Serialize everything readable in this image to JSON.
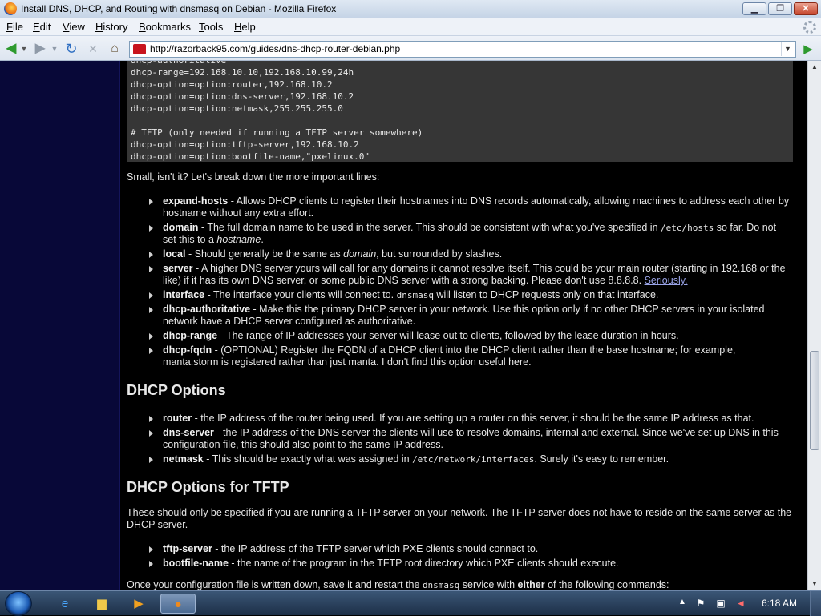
{
  "window": {
    "title": "Install DNS, DHCP, and Routing with dnsmasq on Debian - Mozilla Firefox",
    "min": "▁",
    "max": "❐",
    "close": "✕"
  },
  "menu": [
    "File",
    "Edit",
    "View",
    "History",
    "Bookmarks",
    "Tools",
    "Help"
  ],
  "menu_access_keys": [
    "F",
    "E",
    "V",
    "H",
    "B",
    "T",
    "H"
  ],
  "nav": {
    "url": "http://razorback95.com/guides/dns-dhcp-router-debian.php"
  },
  "code_lines": [
    "dhcp-authoritative",
    "dhcp-range=192.168.10.10,192.168.10.99,24h",
    "dhcp-option=option:router,192.168.10.2",
    "dhcp-option=option:dns-server,192.168.10.2",
    "dhcp-option=option:netmask,255.255.255.0",
    "",
    "# TFTP (only needed if running a TFTP server somewhere)",
    "dhcp-option=option:tftp-server,192.168.10.2",
    "dhcp-option=option:bootfile-name,\"pxelinux.0\""
  ],
  "intro": "Small, isn't it? Let's break down the more important lines:",
  "options": [
    {
      "term": "expand-hosts",
      "text": " - Allows DHCP clients to register their hostnames into DNS records automatically, allowing machines to address each other by hostname without any extra effort."
    },
    {
      "term": "domain",
      "pre": " - The full domain name to be used in the server. This should be consistent with what you've specified in ",
      "mono": "/etc/hosts",
      "post": " so far. Do not set this to a ",
      "italic": "hostname",
      "end": "."
    },
    {
      "term": "local",
      "pre": " - Should generally be the same as ",
      "italic": "domain",
      "post": ", but surrounded by slashes."
    },
    {
      "term": "server",
      "pre": " - A higher DNS server yours will call for any domains it cannot resolve itself. This could be your main router (starting in 192.168 or the like) if it has its own DNS server, or some public DNS server with a strong backing. Please don't use 8.8.8.8. ",
      "link": "Seriously."
    },
    {
      "term": "interface",
      "pre": " - The interface your clients will connect to. ",
      "mono": "dnsmasq",
      "post": " will listen to DHCP requests only on that interface."
    },
    {
      "term": "dhcp-authoritative",
      "text": " - Make this the primary DHCP server in your network. Use this option only if no other DHCP servers in your isolated network have a DHCP server configured as authoritative."
    },
    {
      "term": "dhcp-range",
      "text": " - The range of IP addresses your server will lease out to clients, followed by the lease duration in hours."
    },
    {
      "term": "dhcp-fqdn",
      "text": " - (OPTIONAL) Register the FQDN of a DHCP client into the DHCP client rather than the base hostname; for example, manta.storm is registered rather than just manta. I don't find this option useful here."
    }
  ],
  "dhcp_options_heading": "DHCP Options",
  "dhcp_options": [
    {
      "term": "router",
      "text": " - the IP address of the router being used. If you are setting up a router on this server, it should be the same IP address as that."
    },
    {
      "term": "dns-server",
      "text": " - the IP address of the DNS server the clients will use to resolve domains, internal and external. Since we've set up DNS in this configuration file, this should also point to the same IP address."
    },
    {
      "term": "netmask",
      "pre": " - This should be exactly what was assigned in ",
      "mono": "/etc/network/interfaces",
      "post": ". Surely it's easy to remember."
    }
  ],
  "tftp_heading": "DHCP Options for TFTP",
  "tftp_intro": "These should only be specified if you are running a TFTP server on your network. The TFTP server does not have to reside on the same server as the DHCP server.",
  "tftp_options": [
    {
      "term": "tftp-server",
      "text": " - the IP address of the TFTP server which PXE clients should connect to."
    },
    {
      "term": "bootfile-name",
      "text": " - the name of the program in the TFTP root directory which PXE clients should execute."
    }
  ],
  "outro": {
    "pre": "Once your configuration file is written down, save it and restart the ",
    "mono": "dnsmasq",
    "mid": " service with ",
    "bold": "either",
    "post": " of the following commands:"
  },
  "taskbar": {
    "clock": "6:18 AM"
  },
  "colors": {
    "page_bg": "#000000",
    "left_strip": "#080838",
    "code_bg": "#363636",
    "link": "#9aa4e8"
  },
  "icons": [
    "firefox-icon",
    "back-arrow-icon",
    "forward-arrow-icon",
    "reload-icon",
    "stop-icon",
    "home-icon",
    "site-favicon",
    "go-arrow-icon",
    "windows-start-icon",
    "internet-explorer-icon",
    "explorer-folder-icon",
    "media-player-icon",
    "flag-icon",
    "network-icon",
    "volume-icon"
  ]
}
